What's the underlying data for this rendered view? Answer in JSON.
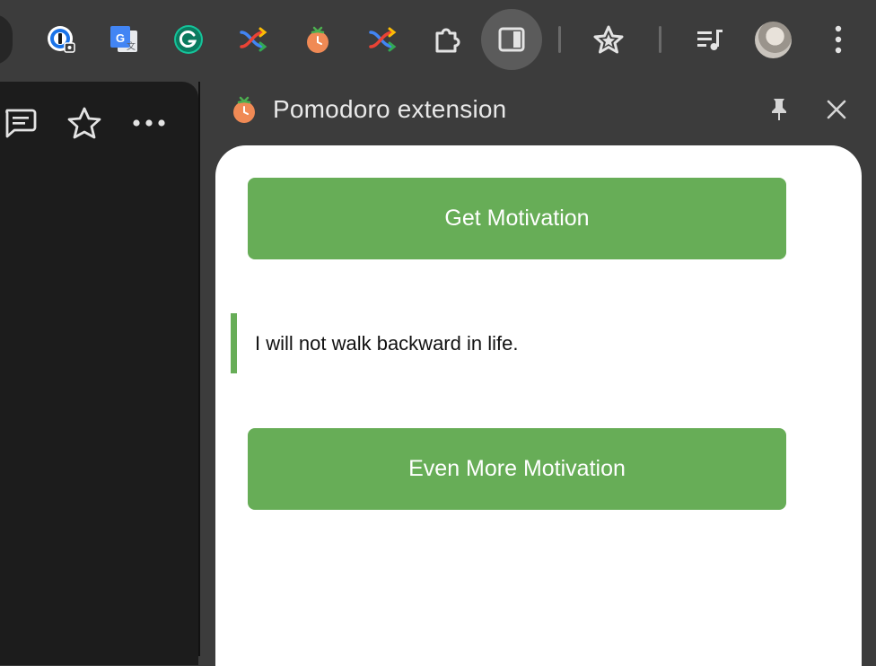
{
  "toolbar": {
    "extension_icons": [
      "onepassword-icon",
      "google-translate-icon",
      "grammarly-icon",
      "shuffle-extension-icon",
      "pomodoro-tomato-icon",
      "shuffle-extension-icon-2",
      "puzzle-extensions-icon",
      "side-panel-icon",
      "bookmark-star-icon",
      "reading-list-icon",
      "profile-avatar",
      "more-menu-icon"
    ]
  },
  "page": {
    "header_icons": [
      "comment-icon",
      "star-icon",
      "more-dots-icon"
    ]
  },
  "side_panel": {
    "title": "Pomodoro extension",
    "pin_icon": "pin-icon",
    "close_icon": "close-icon"
  },
  "content": {
    "get_motivation_label": "Get Motivation",
    "quote": "I will not walk backward in life.",
    "more_motivation_label": "Even More Motivation"
  },
  "colors": {
    "accent_green": "#67ad57",
    "chrome_bg": "#3c3c3c",
    "page_bg": "#1c1c1c",
    "panel_bg": "#ffffff"
  }
}
